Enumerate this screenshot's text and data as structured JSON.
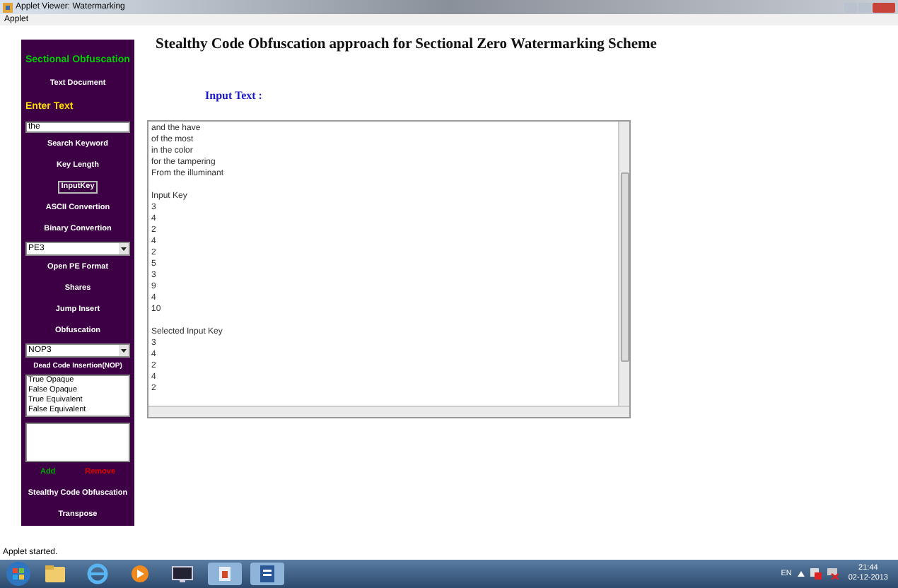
{
  "window": {
    "title": "Applet Viewer: Watermarking"
  },
  "menu": [
    "Applet"
  ],
  "sidebar": [
    {
      "kind": "heading",
      "text": "Sectional Obfuscation",
      "color": "#00cc00"
    },
    {
      "kind": "button",
      "text": "Text Document",
      "focused": false
    },
    {
      "kind": "heading",
      "text": "Enter Text",
      "color": "#ffdd00"
    },
    {
      "kind": "input",
      "value": "the"
    },
    {
      "kind": "button",
      "text": "Search Keyword",
      "focused": false
    },
    {
      "kind": "button",
      "text": "Key Length",
      "focused": false
    },
    {
      "kind": "button",
      "text": "InputKey",
      "focused": true
    },
    {
      "kind": "button",
      "text": "ASCII Convertion",
      "focused": false
    },
    {
      "kind": "button",
      "text": "Binary Convertion",
      "focused": false
    },
    {
      "kind": "select",
      "value": "PE3"
    },
    {
      "kind": "button",
      "text": "Open PE Format",
      "focused": false
    },
    {
      "kind": "button",
      "text": "Shares",
      "focused": false
    },
    {
      "kind": "button",
      "text": "Jump Insert",
      "focused": false
    },
    {
      "kind": "button",
      "text": "Obfuscation",
      "focused": false
    },
    {
      "kind": "select",
      "value": "NOP3"
    },
    {
      "kind": "label",
      "text": "Dead Code Insertion(NOP)"
    },
    {
      "kind": "listbox",
      "items": [
        "True Opaque",
        "False Opaque",
        "True Equivalent",
        "False Equivalent"
      ]
    },
    {
      "kind": "textarea"
    },
    {
      "kind": "actions",
      "buttons": [
        {
          "text": "Add",
          "color": "#00aa00"
        },
        {
          "text": "Remove",
          "color": "#dd0000"
        }
      ]
    },
    {
      "kind": "button",
      "text": "Stealthy Code Obfuscation",
      "focused": false
    },
    {
      "kind": "button",
      "text": "Transpose",
      "focused": false
    }
  ],
  "main": {
    "title": "Stealthy Code Obfuscation approach for Sectional Zero Watermarking Scheme",
    "input_label": "Input Text :",
    "text_blocks": [
      [
        "and the have",
        "of the most",
        "in the color",
        "for the tampering",
        "From the illuminant"
      ],
      [
        "Input Key",
        "3",
        "4",
        "2",
        "4",
        "2",
        "5",
        "3",
        "9",
        "4",
        "10"
      ],
      [
        "Selected Input Key",
        "3",
        "4",
        "2",
        "4",
        "2"
      ]
    ]
  },
  "status_bar": "Applet started.",
  "taskbar": {
    "language": "EN",
    "time": "21:44",
    "date": "02-12-2013"
  }
}
